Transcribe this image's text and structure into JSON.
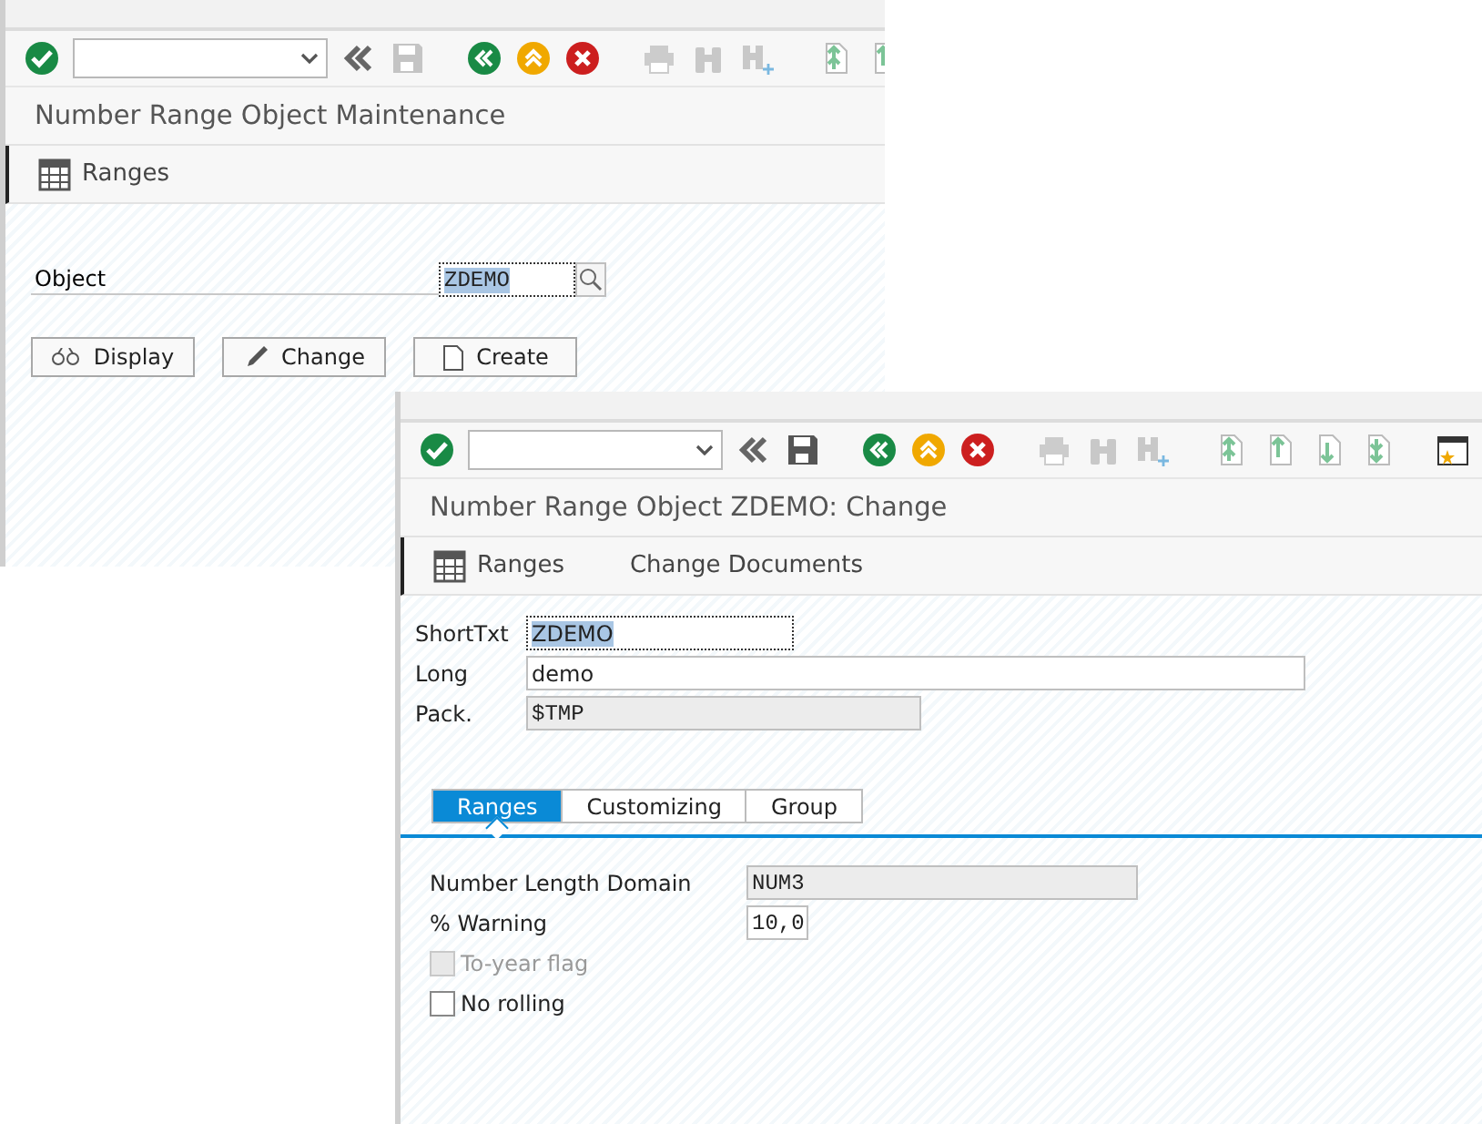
{
  "maintenance_window": {
    "title": "Number Range Object Maintenance",
    "save_disabled": true,
    "app_toolbar": [
      {
        "label": "Ranges",
        "kind": "table"
      }
    ],
    "fields": [
      {
        "label": "Object",
        "value": "ZDEMO",
        "kind": "code",
        "selected": true
      }
    ],
    "buttons": [
      {
        "label": "Display",
        "kind": "display"
      },
      {
        "label": "Change",
        "kind": "change"
      },
      {
        "label": "Create",
        "kind": "create"
      }
    ]
  },
  "change_window": {
    "title": "Number Range Object ZDEMO: Change",
    "save_disabled": false,
    "app_toolbar": [
      {
        "label": "Ranges",
        "kind": "table"
      },
      {
        "label": "Change Documents",
        "kind": "text"
      }
    ],
    "header_fields": [
      {
        "label": "ShortTxt",
        "value": "ZDEMO",
        "kind": "text",
        "selected": true,
        "disabled": false
      },
      {
        "label": "Long",
        "value": "demo",
        "kind": "text",
        "selected": false,
        "disabled": false
      },
      {
        "label": "Pack.",
        "value": "$TMP",
        "kind": "code",
        "selected": false,
        "disabled": true
      }
    ],
    "tabs": [
      {
        "label": "Ranges",
        "selected": true
      },
      {
        "label": "Customizing",
        "selected": false
      },
      {
        "label": "Group",
        "selected": false
      }
    ],
    "tab_fields": [
      {
        "kind": "field",
        "label": "Number Length Domain",
        "value": "NUM3",
        "disabled": true
      },
      {
        "kind": "field",
        "label": "% Warning",
        "value": "10,0",
        "disabled": false
      },
      {
        "kind": "checkbox",
        "label": "To-year flag",
        "checked": false,
        "disabled": true
      },
      {
        "kind": "checkbox",
        "label": "No rolling",
        "checked": false,
        "disabled": false
      }
    ]
  }
}
